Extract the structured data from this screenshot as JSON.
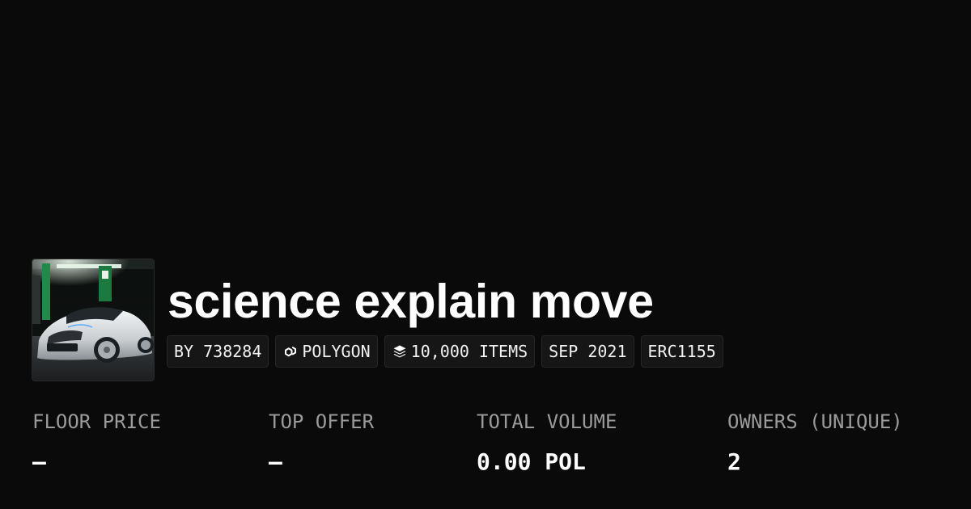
{
  "collection": {
    "name": "science explain move",
    "avatar_icon": "car-photo-image"
  },
  "chips": {
    "creator": "BY 738284",
    "chain": "POLYGON",
    "chain_icon": "polygon-chain-icon",
    "items": "10,000 ITEMS",
    "items_icon": "layers-icon",
    "date": "SEP 2021",
    "standard": "ERC1155"
  },
  "stats": [
    {
      "label": "FLOOR PRICE",
      "value": "–"
    },
    {
      "label": "TOP OFFER",
      "value": "–"
    },
    {
      "label": "TOTAL VOLUME",
      "value": "0.00 POL"
    },
    {
      "label": "OWNERS (UNIQUE)",
      "value": "2"
    }
  ],
  "colors": {
    "background": "#0a0a0a",
    "chip_background": "#161616",
    "label": "#9b9b9b",
    "text": "#ffffff"
  }
}
